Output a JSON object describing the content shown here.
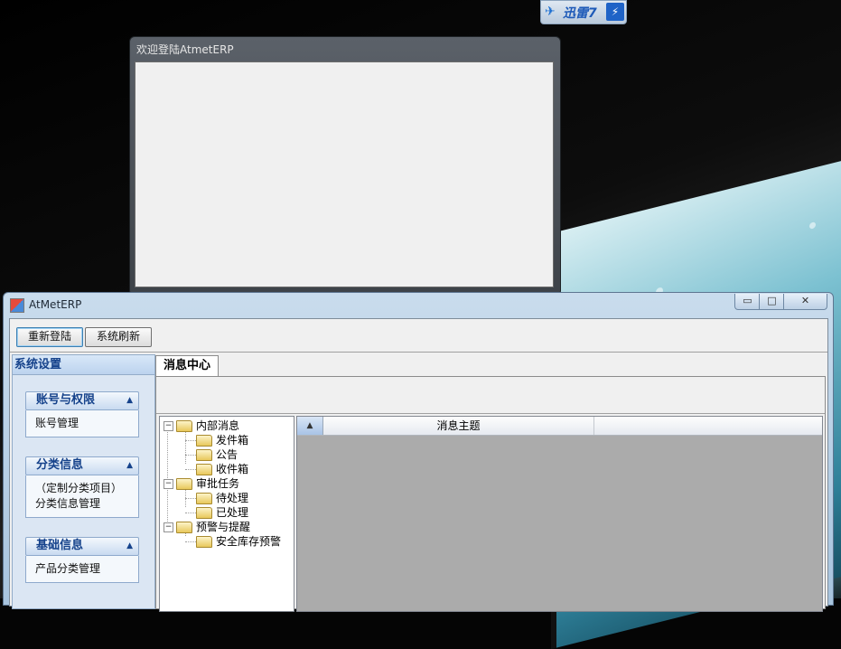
{
  "xunlei_badge": {
    "text": "迅雷7",
    "bolt": "⚡"
  },
  "login_window": {
    "title": "欢迎登陆AtmetERP"
  },
  "main_window": {
    "title": "AtMetERP",
    "controls": {
      "minimize": "▭",
      "maximize": "□",
      "close": "✕"
    },
    "toolbar": {
      "relogin_label": "重新登陆",
      "refresh_label": "系统刷新"
    },
    "sidebar": {
      "header": "系统设置",
      "groups": [
        {
          "title": "账号与权限",
          "items": [
            "账号管理"
          ]
        },
        {
          "title": "分类信息",
          "items": [
            "（定制分类项目）",
            "分类信息管理"
          ]
        },
        {
          "title": "基础信息",
          "items": [
            "产品分类管理"
          ]
        }
      ]
    },
    "tab": {
      "label": "消息中心"
    },
    "tree": {
      "nodes": [
        {
          "label": "内部消息",
          "children": [
            "发件箱",
            "公告",
            "收件箱"
          ]
        },
        {
          "label": "审批任务",
          "children": [
            "待处理",
            "已处理"
          ]
        },
        {
          "label": "预警与提醒",
          "children": [
            "安全库存预警"
          ]
        }
      ]
    },
    "grid": {
      "columns": [
        "消息主题"
      ]
    }
  }
}
